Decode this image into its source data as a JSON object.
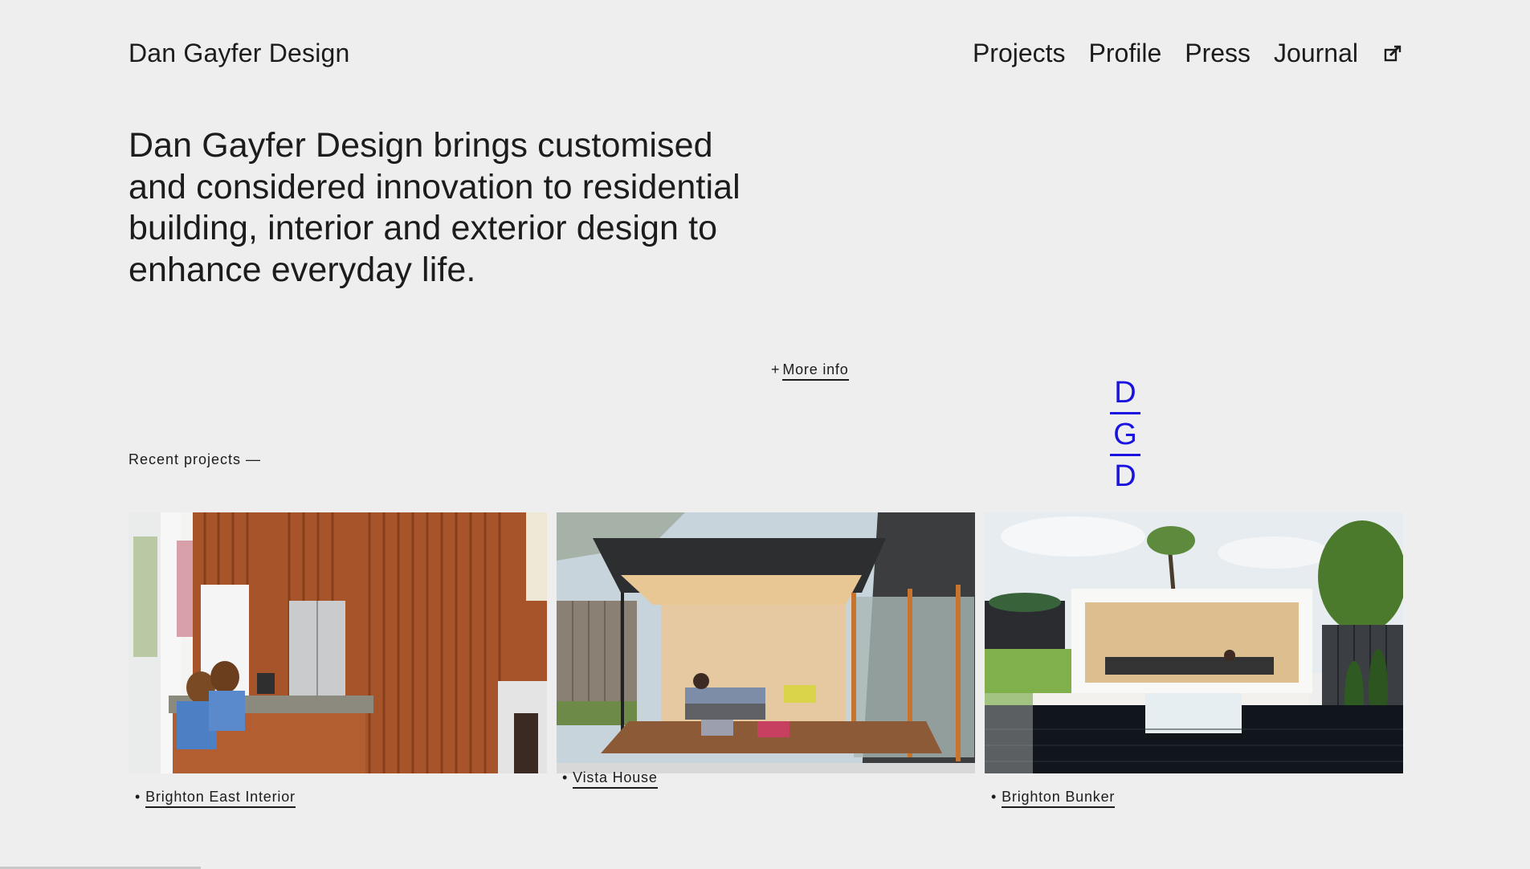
{
  "header": {
    "brand": "Dan Gayfer Design",
    "nav": [
      "Projects",
      "Profile",
      "Press",
      "Journal"
    ],
    "edit_icon": "external-edit-icon"
  },
  "intro": {
    "text": "Dan Gayfer Design brings customised and considered innovation to residential building, interior and exterior design to enhance everyday life."
  },
  "more_info": {
    "plus": "+",
    "label": "More info"
  },
  "monogram": {
    "letters": [
      "D",
      "G",
      "D"
    ],
    "color": "#1a12e0"
  },
  "recent": {
    "label": "Recent projects —"
  },
  "projects": [
    {
      "bullet": "•",
      "title": "Brighton East Interior"
    },
    {
      "bullet": "•",
      "title": "Vista House"
    },
    {
      "bullet": "•",
      "title": "Brighton Bunker"
    }
  ]
}
